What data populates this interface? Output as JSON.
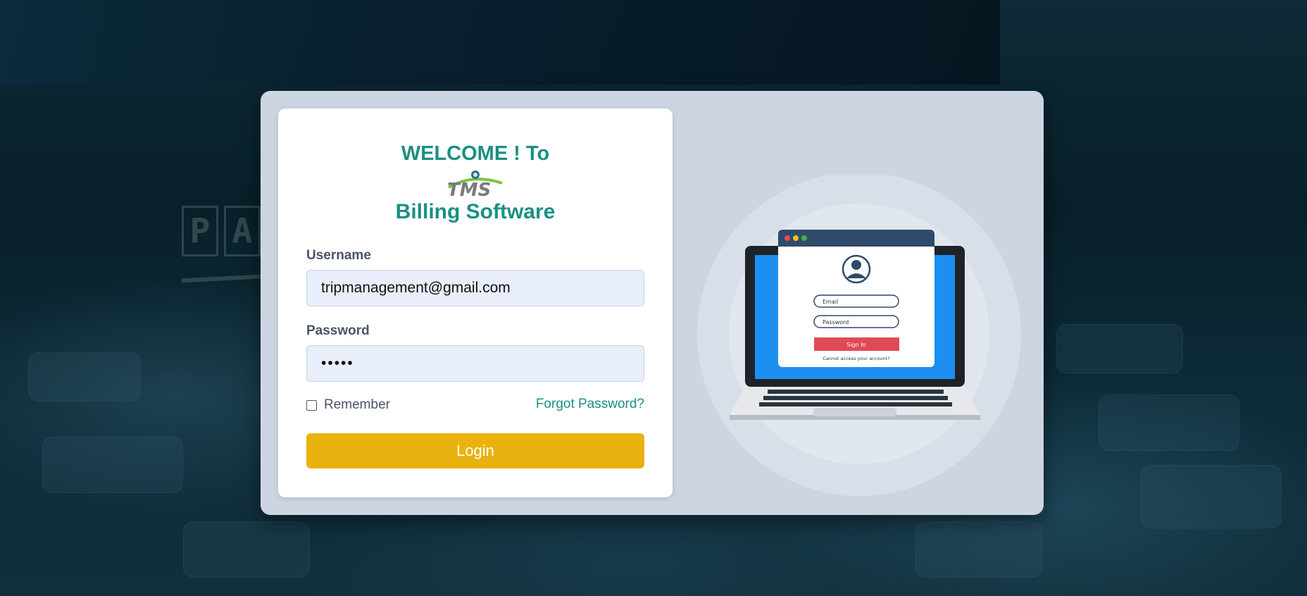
{
  "welcome": "WELCOME ! To",
  "logo_name": "tms-logo",
  "product_name": "Billing Software",
  "form": {
    "username_label": "Username",
    "username_value": "tripmanagement@gmail.com",
    "password_label": "Password",
    "password_value": "•••••",
    "remember_label": "Remember",
    "remember_checked": false,
    "forgot_label": "Forgot Password?",
    "login_label": "Login"
  },
  "illustration": {
    "email_placeholder": "Email",
    "password_placeholder": "Password",
    "signin_label": "Sign In",
    "help_text": "Cannot access your account?"
  },
  "colors": {
    "accent": "#1a9082",
    "button": "#e9b20e",
    "container": "#ccd5e1",
    "input_bg": "#e8eefa",
    "illustration_button": "#e04a55"
  }
}
